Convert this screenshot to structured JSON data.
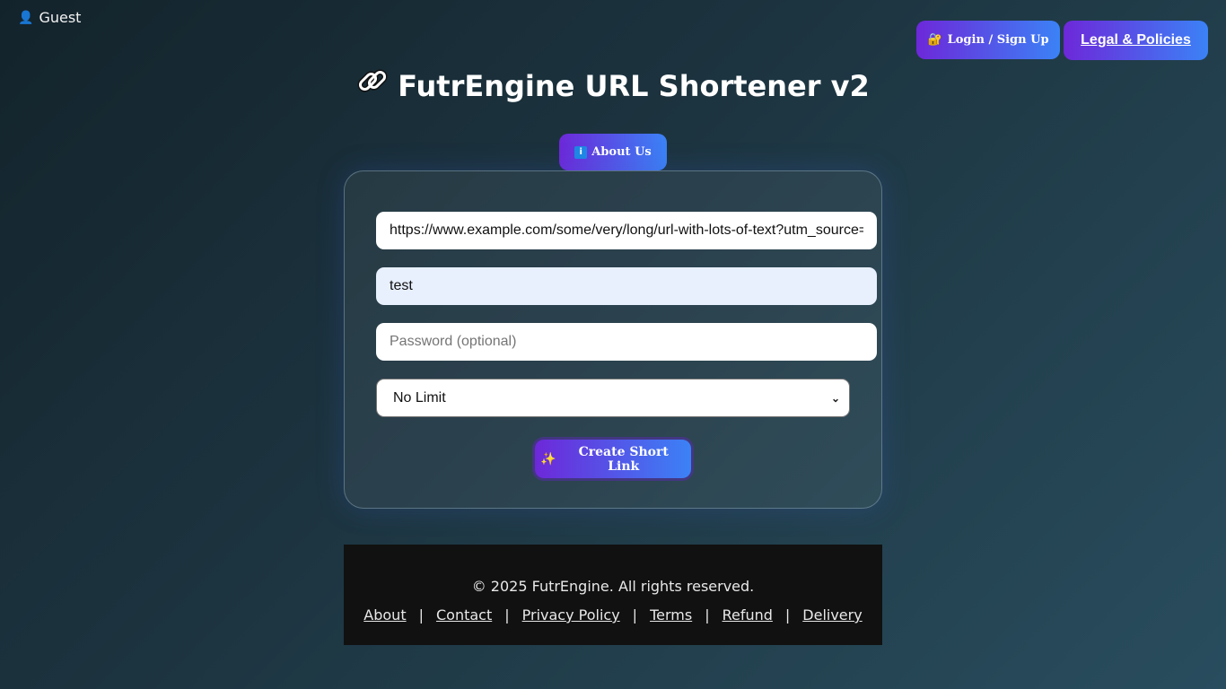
{
  "user": {
    "icon": "bust-silhouette-icon",
    "name": "Guest"
  },
  "header": {
    "login_label": "Login / Sign Up",
    "login_icon": "lock-icon",
    "legal_label": "Legal & Policies"
  },
  "title": {
    "icon": "link-icon",
    "text": "FutrEngine URL Shortener v2"
  },
  "about_button": {
    "label": "About Us",
    "icon": "info-icon"
  },
  "form": {
    "url_value": "https://www.example.com/some/very/long/url-with-lots-of-text?utm_source=",
    "alias_value": "test",
    "password_placeholder": "Password (optional)",
    "limit_selected": "No Limit",
    "create_label": "Create Short Link",
    "create_icon": "sparkles-icon"
  },
  "footer": {
    "copyright": "© 2025 FutrEngine. All rights reserved.",
    "links": [
      "About",
      "Contact",
      "Privacy Policy",
      "Terms",
      "Refund",
      "Delivery"
    ]
  },
  "colors": {
    "button_gradient_start": "#6d28d9",
    "button_gradient_end": "#3b82f6",
    "footer_bg": "#111111"
  }
}
